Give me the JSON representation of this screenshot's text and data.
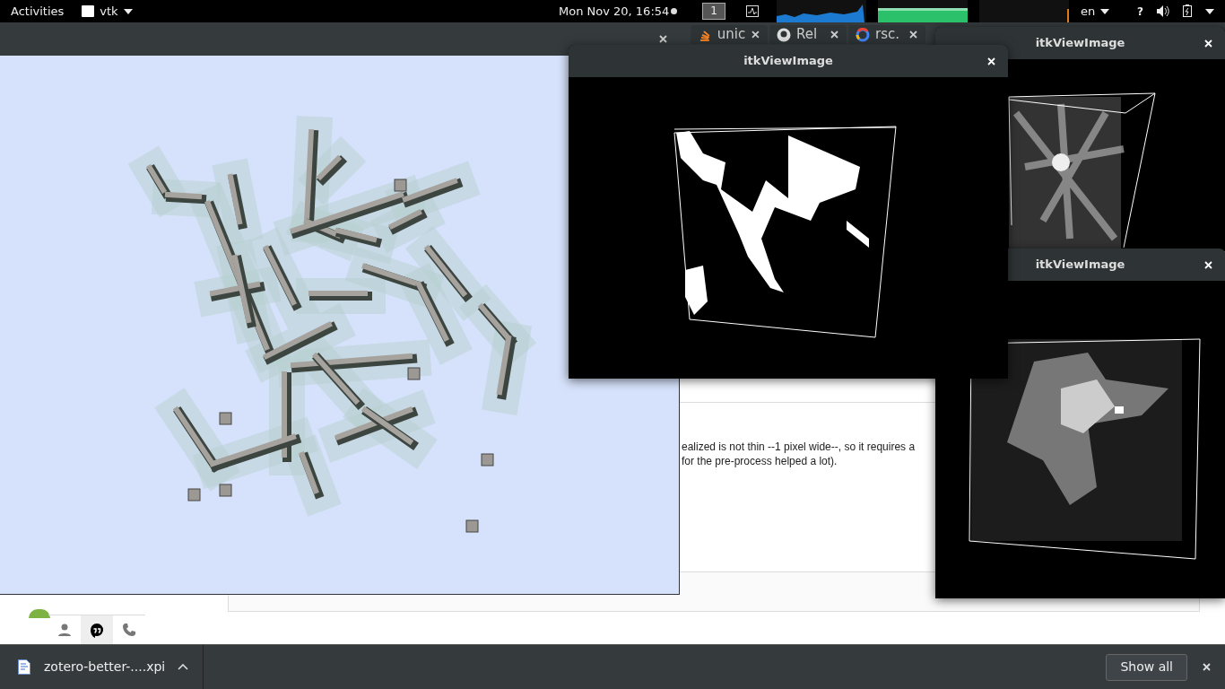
{
  "top_bar": {
    "activities": "Activities",
    "app_menu": "vtk",
    "clock": "Mon Nov 20, 16:54",
    "workspace": "1",
    "language": "en",
    "help": "?"
  },
  "browser": {
    "tabs": [
      {
        "label": "unic",
        "kind": "stack"
      },
      {
        "label": "Rel",
        "kind": "github"
      },
      {
        "label": "rsc.",
        "kind": "google"
      }
    ],
    "message_lines": [
      "ealized is not thin --1 pixel wide--, so it requires a",
      "for the pre-process helped a lot)."
    ],
    "chat_tabs": [
      {
        "kind": "person",
        "selected": false
      },
      {
        "kind": "quote",
        "selected": true
      },
      {
        "kind": "phone",
        "selected": false
      }
    ]
  },
  "itk_windows": [
    {
      "title": "itkViewImage",
      "kind": "gray-small"
    },
    {
      "title": "itkViewImage",
      "kind": "gray"
    },
    {
      "title": "itkViewImage",
      "kind": "binary"
    }
  ],
  "downloads": {
    "file": "zotero-better-....xpi",
    "show_all": "Show all"
  }
}
